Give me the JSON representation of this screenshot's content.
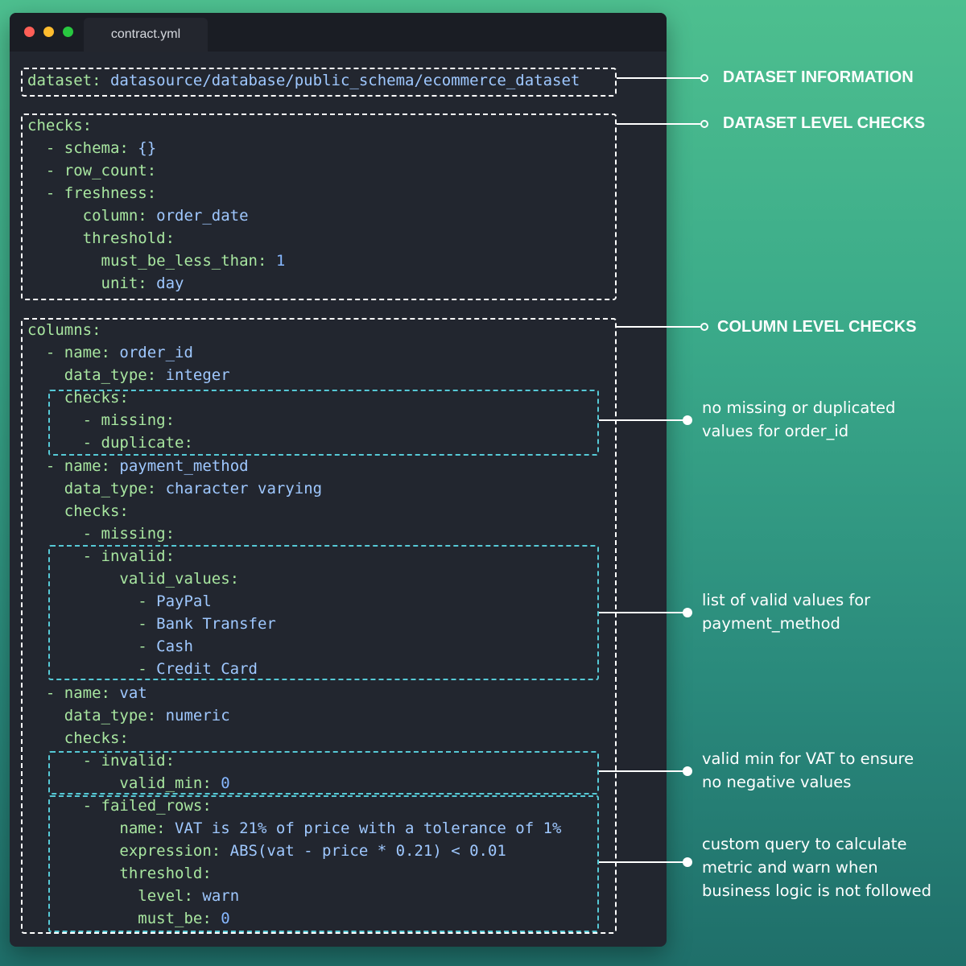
{
  "window": {
    "tab_title": "contract.yml",
    "traffic_lights": {
      "close": "#ff5f57",
      "minimize": "#febc2e",
      "maximize": "#28c840"
    }
  },
  "code": {
    "l1": {
      "key": "dataset",
      "value": "datasource/database/public_schema/ecommerce_dataset"
    },
    "l2": {
      "key": "checks"
    },
    "l3": {
      "key": "schema",
      "value": "{}"
    },
    "l4": {
      "key": "row_count"
    },
    "l5": {
      "key": "freshness"
    },
    "l6": {
      "key": "column",
      "value": "order_date"
    },
    "l7": {
      "key": "threshold"
    },
    "l8": {
      "key": "must_be_less_than",
      "value": "1"
    },
    "l9": {
      "key": "unit",
      "value": "day"
    },
    "l10": {
      "key": "columns"
    },
    "l11": {
      "key": "name",
      "value": "order_id"
    },
    "l12": {
      "key": "data_type",
      "value": "integer"
    },
    "l13": {
      "key": "checks"
    },
    "l14": {
      "key": "missing"
    },
    "l15": {
      "key": "duplicate"
    },
    "l16": {
      "key": "name",
      "value": "payment_method"
    },
    "l17": {
      "key": "data_type",
      "value": "character varying"
    },
    "l18": {
      "key": "checks"
    },
    "l19": {
      "key": "missing"
    },
    "l20": {
      "key": "invalid"
    },
    "l21": {
      "key": "valid_values"
    },
    "l22": {
      "value": "PayPal"
    },
    "l23": {
      "value": "Bank Transfer"
    },
    "l24": {
      "value": "Cash"
    },
    "l25": {
      "value": "Credit Card"
    },
    "l26": {
      "key": "name",
      "value": "vat"
    },
    "l27": {
      "key": "data_type",
      "value": "numeric"
    },
    "l28": {
      "key": "checks"
    },
    "l29": {
      "key": "invalid"
    },
    "l30": {
      "key": "valid_min",
      "value": "0"
    },
    "l31": {
      "key": "failed_rows"
    },
    "l32": {
      "key": "name",
      "value": "VAT is 21% of price with a tolerance of 1%"
    },
    "l33": {
      "key": "expression",
      "value": "ABS(vat - price * 0.21) < 0.01"
    },
    "l34": {
      "key": "threshold"
    },
    "l35": {
      "key": "level",
      "value": "warn"
    },
    "l36": {
      "key": "must_be",
      "value": "0"
    }
  },
  "annotations": {
    "dataset_information": "DATASET INFORMATION",
    "dataset_level_checks": "DATASET LEVEL CHECKS",
    "column_level_checks": "COLUMN LEVEL CHECKS",
    "order_id_note": [
      "no missing or duplicated",
      "values for order_id"
    ],
    "payment_note": [
      "list of valid values for",
      "payment_method"
    ],
    "vat_note": [
      "valid min for VAT to ensure",
      "no negative values"
    ],
    "custom_query_note": [
      "custom query to calculate",
      "metric and warn when",
      "business logic is not followed"
    ]
  },
  "colors": {
    "key": "#a8e6a0",
    "value": "#9fc8ff",
    "outer_box": "#ffffff",
    "inner_box": "#56c9d6"
  }
}
